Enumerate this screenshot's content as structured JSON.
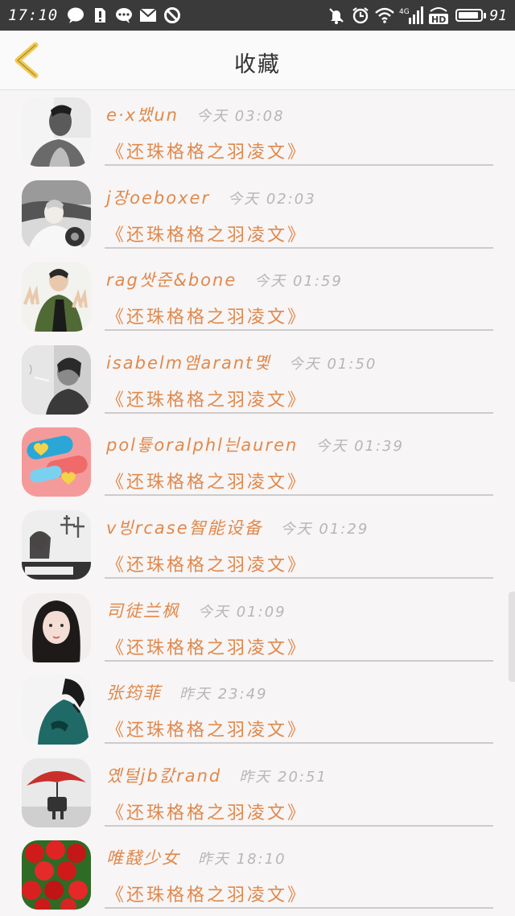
{
  "status_bar": {
    "time": "17:10",
    "battery_percent": "91",
    "battery_level": 0.91,
    "network": "4G",
    "hd_badge": "HD",
    "left_icons": [
      "chat-bubble-icon",
      "sim-alert-icon",
      "message-icon",
      "mail-icon",
      "block-icon"
    ],
    "right_icons": [
      "mute-icon",
      "alarm-icon",
      "wifi-icon",
      "signal-4g-icon",
      "hd-icon",
      "battery-icon"
    ]
  },
  "header": {
    "title": "收藏",
    "back_icon": "chevron-left-icon",
    "back_color": "#f2c94c"
  },
  "colors": {
    "accent": "#e0894d",
    "meta_gray": "#b9b5b5"
  },
  "favorites": [
    {
      "name": "e·x뱄un",
      "time": "今天 03:08",
      "work": "《还珠格格之羽凌文》",
      "avatar": "portrait-man-bw"
    },
    {
      "name": "j장oeboxer",
      "time": "今天 02:03",
      "work": "《还珠格格之羽凌文》",
      "avatar": "man-with-motorbike"
    },
    {
      "name": "rag쌋준&bone",
      "time": "今天 01:59",
      "work": "《还珠格格之羽凌文》",
      "avatar": "boy-peace-sign"
    },
    {
      "name": "isabelm앰arant몣",
      "time": "今天 01:50",
      "work": "《还珠格格之羽凌文》",
      "avatar": "smoker-bw"
    },
    {
      "name": "pol튷oralphl늰auren",
      "time": "今天 01:39",
      "work": "《还珠格格之羽凌文》",
      "avatar": "candy-hearts"
    },
    {
      "name": "v빙rcase智能设备",
      "time": "今天 01:29",
      "work": "《还珠格格之羽凌文》",
      "avatar": "girl-with-text"
    },
    {
      "name": "司徒兰枫",
      "time": "今天 01:09",
      "work": "《还珠格格之羽凌文》",
      "avatar": "girl-long-hair"
    },
    {
      "name": "张筠菲",
      "time": "昨天 23:49",
      "work": "《还珠格格之羽凌文》",
      "avatar": "person-green-jacket"
    },
    {
      "name": "옜털jb캀rand",
      "time": "昨天 20:51",
      "work": "《还珠格格之羽凌文》",
      "avatar": "red-umbrella"
    },
    {
      "name": "唯馢少女",
      "time": "昨天 18:10",
      "work": "《还珠格格之羽凌文》",
      "avatar": "red-roses"
    }
  ]
}
